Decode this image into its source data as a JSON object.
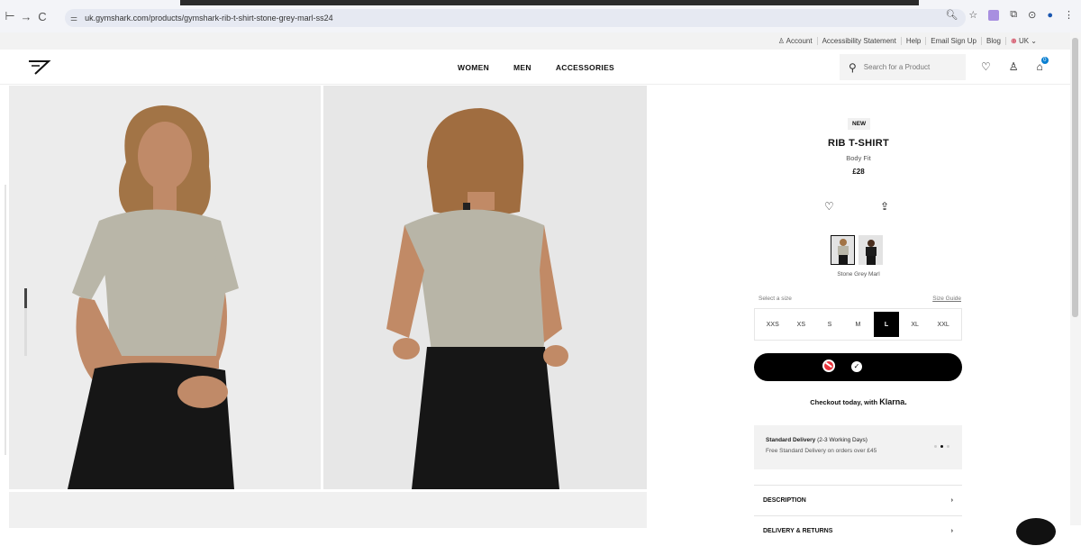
{
  "browser": {
    "url": "uk.gymshark.com/products/gymshark-rib-t-shirt-stone-grey-marl-ss24",
    "back_icon": "back-icon",
    "forward_icon": "forward-icon",
    "reload_icon": "reload-icon"
  },
  "utility_bar": {
    "account": "Account",
    "accessibility": "Accessibility Statement",
    "help": "Help",
    "email": "Email Sign Up",
    "blog": "Blog",
    "region": "UK"
  },
  "header": {
    "nav": [
      "WOMEN",
      "MEN",
      "ACCESSORIES"
    ],
    "search_placeholder": "Search for a Product"
  },
  "product": {
    "tag": "NEW",
    "title": "RIB T-SHIRT",
    "fit": "Body Fit",
    "price": "£28",
    "color_name": "Stone Grey Marl",
    "select_size_label": "Select a size",
    "size_guide": "Size Guide",
    "sizes": [
      "XXS",
      "XS",
      "S",
      "M",
      "L",
      "XL",
      "XXL"
    ],
    "selected_size": "L",
    "checkout_text": "Checkout today, with",
    "checkout_brand": "Klarna.",
    "delivery_title": "Standard Delivery",
    "delivery_days": "(2-3 Working Days)",
    "delivery_note": "Free Standard Delivery on orders over £45",
    "accordions": [
      "DESCRIPTION",
      "DELIVERY & RETURNS"
    ]
  },
  "colors": {
    "accent_badge": "#0a7fd1",
    "button": "#000000",
    "no_icon": "#e8333b"
  }
}
